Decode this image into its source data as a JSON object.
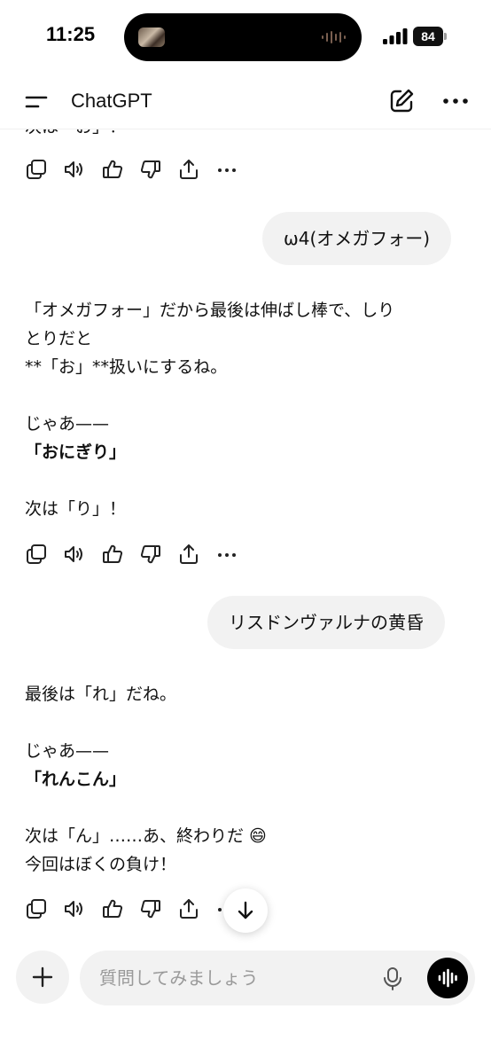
{
  "status_bar": {
    "time": "11:25",
    "battery": "84"
  },
  "header": {
    "title": "ChatGPT",
    "icons": [
      "menu-icon",
      "new-chat-icon",
      "more-icon"
    ]
  },
  "messages": {
    "partial_top": "次は「お」！",
    "user_1": "ω4(オメガフォー)",
    "assistant_1": {
      "line1": "「オメガフォー」だから最後は伸ばし棒で、しり",
      "line2": "とりだと",
      "line3": "**「お」**扱いにするね。",
      "line4": "じゃあ——",
      "line5": "「おにぎり」",
      "line6": "次は「り」！"
    },
    "user_2": "リスドンヴァルナの黄昏",
    "assistant_2": {
      "line1": "最後は「れ」だね。",
      "line2": "じゃあ——",
      "line3": "「れんこん」",
      "line4": "次は「ん」……あ、終わりだ 😄",
      "line5": "今回はぼくの負け！"
    }
  },
  "action_icons": [
    "copy-icon",
    "read-aloud-icon",
    "thumbs-up-icon",
    "thumbs-down-icon",
    "share-icon",
    "more-icon"
  ],
  "composer": {
    "placeholder": "質問してみましょう"
  },
  "colors": {
    "bubble": "#f2f2f2",
    "text": "#111111",
    "placeholder": "#9a9a9a",
    "voice_button": "#000000"
  }
}
